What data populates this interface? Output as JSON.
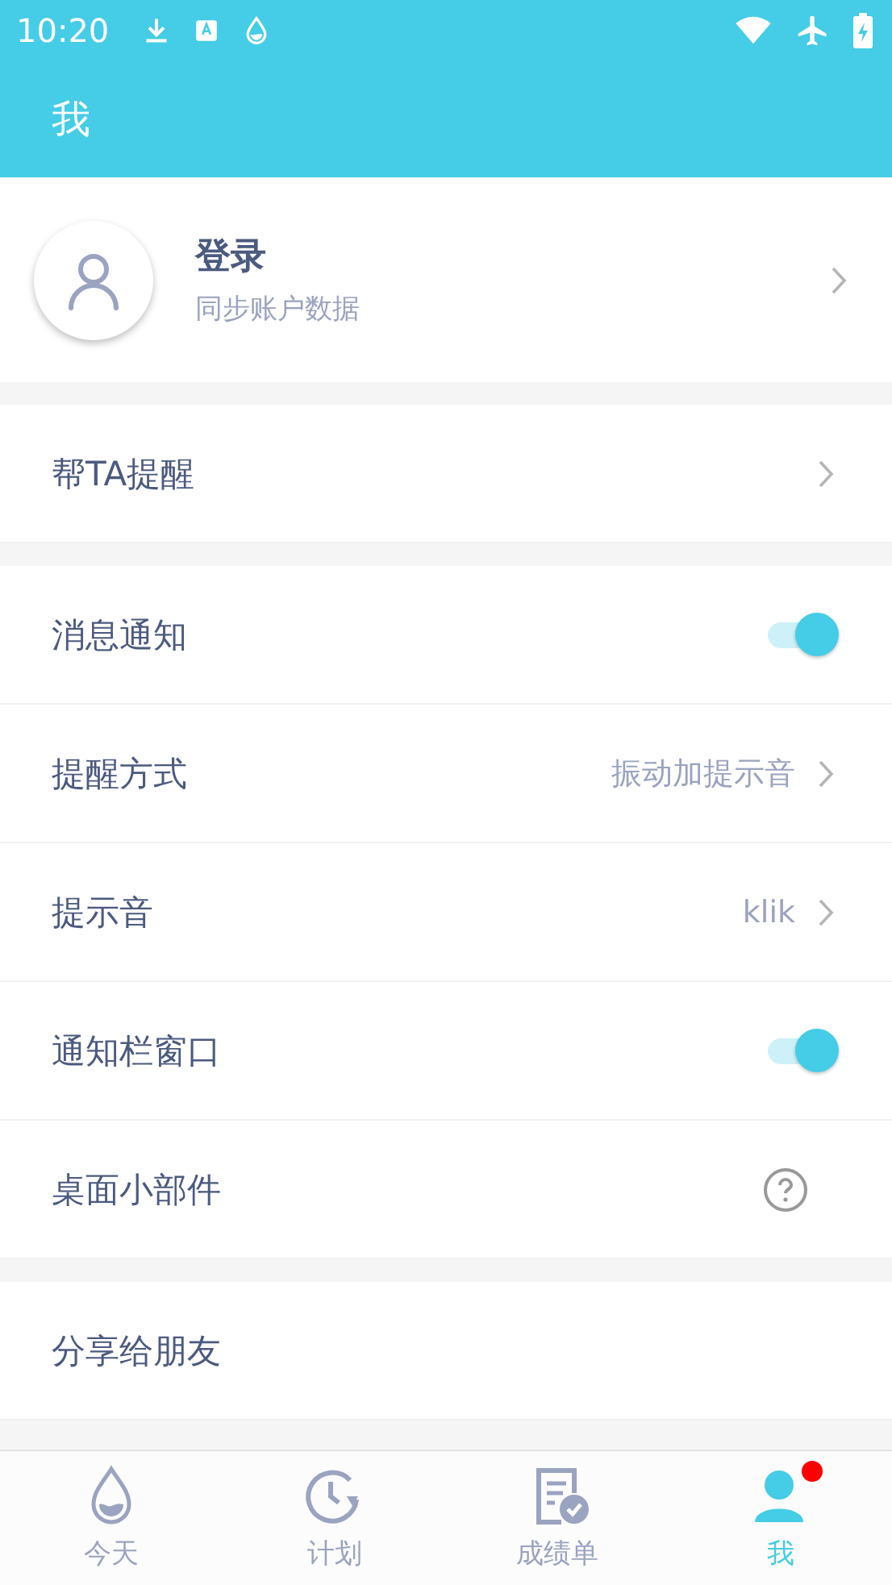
{
  "status_bar": {
    "time": "10:20"
  },
  "app_bar": {
    "title": "我"
  },
  "profile": {
    "name": "登录",
    "subtitle": "同步账户数据"
  },
  "sections": [
    {
      "rows": [
        {
          "kind": "link",
          "label": "帮TA提醒"
        }
      ]
    },
    {
      "rows": [
        {
          "kind": "toggle",
          "label": "消息通知",
          "on": true
        },
        {
          "kind": "value",
          "label": "提醒方式",
          "value": "振动加提示音"
        },
        {
          "kind": "value",
          "label": "提示音",
          "value": "klik"
        },
        {
          "kind": "toggle",
          "label": "通知栏窗口",
          "on": true
        },
        {
          "kind": "help",
          "label": "桌面小部件"
        }
      ]
    },
    {
      "rows": [
        {
          "kind": "plain",
          "label": "分享给朋友"
        }
      ]
    }
  ],
  "tabs": [
    {
      "kind": "drop",
      "label": "今天",
      "selected": false,
      "badge": false
    },
    {
      "kind": "clock",
      "label": "计划",
      "selected": false,
      "badge": false
    },
    {
      "kind": "report",
      "label": "成绩单",
      "selected": false,
      "badge": false
    },
    {
      "kind": "person",
      "label": "我",
      "selected": true,
      "badge": true
    }
  ]
}
